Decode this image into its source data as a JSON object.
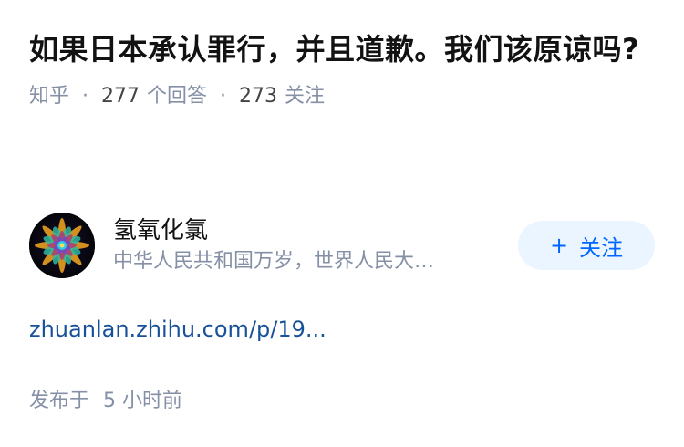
{
  "question": {
    "title": "如果日本承认罪行，并且道歉。我们该原谅吗?",
    "source": "知乎",
    "answer_count": "277",
    "answer_label": "个回答",
    "follow_count": "273",
    "follow_label": "关注",
    "separator": "·"
  },
  "author": {
    "name": "氢氧化氯",
    "bio": "中华人民共和国万岁，世界人民大…",
    "follow_button": {
      "plus": "+",
      "label": "关注",
      "color": "#0066ff",
      "background": "#ebf5ff"
    }
  },
  "article": {
    "link_text": "zhuanlan.zhihu.com/p/19...",
    "link_color": "#175199"
  },
  "publish": {
    "label": "发布于",
    "time": "5 小时前"
  }
}
